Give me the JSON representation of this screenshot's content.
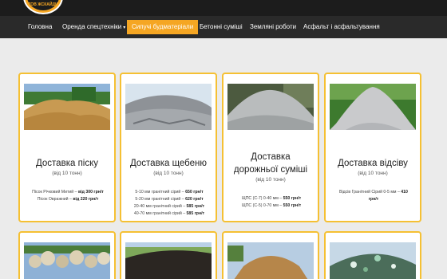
{
  "logo": {
    "text": "ТОВ ЖСКАЙДИ"
  },
  "nav": {
    "items": [
      {
        "label": "Головна"
      },
      {
        "label": "Оренда спецтехніки",
        "chevron": "▾"
      },
      {
        "label": "Сипучі будматеріали"
      },
      {
        "label": "Бетонні суміші"
      },
      {
        "label": "Земляні роботи"
      },
      {
        "label": "Асфальт і асфальтування"
      }
    ],
    "active_index": 2
  },
  "cards": [
    {
      "title": "Доставка піску",
      "subtitle": "(від 10 тонн)",
      "lines": [
        {
          "text": "Пісок Річковий Митий – ",
          "bold": "від 300 грн/т"
        },
        {
          "text": "Пісок Овражний – ",
          "bold": "від 220 грн/т"
        }
      ]
    },
    {
      "title": "Доставка щебеню",
      "subtitle": "(від 10 тонн)",
      "lines": [
        {
          "text": "5-10 мм гранітний сірий – ",
          "bold": "650 грн/т"
        },
        {
          "text": "5-20 мм гранітний сірий – ",
          "bold": "620 грн/т"
        },
        {
          "text": "20-40 мм гранітний сірий – ",
          "bold": "585 грн/т"
        },
        {
          "text": "40-70 мм гранітний сірий – ",
          "bold": "585 грн/т"
        }
      ]
    },
    {
      "title": "Доставка дорожньої суміші",
      "title_line1": "Доставка",
      "title_line2": "дорожньої суміші",
      "subtitle": "(від 10 тонн)",
      "lines": [
        {
          "text": "ЩПС (С-7) 0-40 мм – ",
          "bold": "550 грн/т"
        },
        {
          "text": "ЩПС (С-5) 0-70 мм – ",
          "bold": "550 грн/т"
        }
      ]
    },
    {
      "title": "Доставка відсіву",
      "subtitle": "(від 10 тонн)",
      "lines": [
        {
          "text": "Відсів Гранітний Сірий 0-5 мм – ",
          "bold": "410"
        },
        {
          "text": "",
          "bold": "грн/т"
        }
      ]
    }
  ],
  "colors": {
    "accent": "#f5a623",
    "nav_bg": "#2a2a2a",
    "topbar_bg": "#1c1c1c",
    "card_border": "#f5c033"
  },
  "images": [
    "sand-pile-image",
    "crushed-stone-pile-image",
    "road-mix-pile-image",
    "screenings-pile-image",
    "rubble-stone-image",
    "black-soil-image",
    "clay-pile-image",
    "glass-scrap-image"
  ]
}
